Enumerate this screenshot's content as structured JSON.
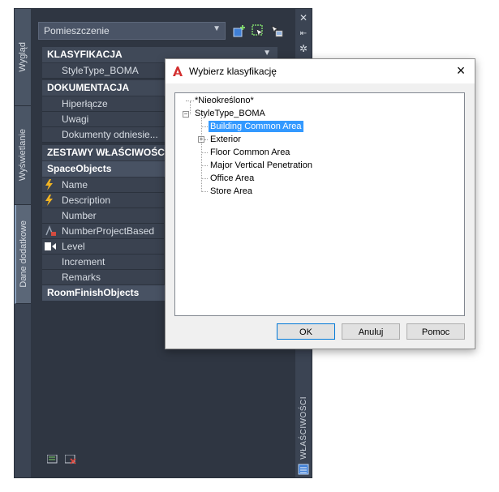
{
  "palette": {
    "side_tabs": [
      "Wygląd",
      "Wyświetlanie",
      "Dane dodatkowe"
    ],
    "dropdown_value": "Pomieszczenie",
    "vertical_title": "WŁAŚCIWOŚCI",
    "sections": {
      "klasyfikacja": {
        "title": "KLASYFIKACJA",
        "rows": [
          "StyleType_BOMA"
        ]
      },
      "dokumentacja": {
        "title": "DOKUMENTACJA",
        "rows": [
          "Hiperłącze",
          "Uwagi",
          "Dokumenty odniesie..."
        ]
      },
      "zestawy": {
        "title": "ZESTAWY WŁAŚCIWOŚCI"
      },
      "space_objects": {
        "title": "SpaceObjects",
        "rows": [
          "Name",
          "Description",
          "Number",
          "NumberProjectBased",
          "Level",
          "Increment",
          "Remarks"
        ]
      },
      "room_finish": {
        "title": "RoomFinishObjects"
      }
    },
    "icons": {
      "add_set": "add-property-set-icon",
      "select_objects": "select-objects-icon",
      "quick_select": "quick-select-icon"
    }
  },
  "dialog": {
    "title": "Wybierz klasyfikację",
    "tree": {
      "unspecified": "*Nieokreślono*",
      "root": "StyleType_BOMA",
      "children": [
        "Building Common Area",
        "Exterior",
        "Floor Common Area",
        "Major Vertical Penetration",
        "Office Area",
        "Store Area"
      ],
      "selected": "Building Common Area"
    },
    "buttons": {
      "ok": "OK",
      "cancel": "Anuluj",
      "help": "Pomoc"
    }
  },
  "colors": {
    "palette_bg": "#2f3642",
    "selection": "#3399ff",
    "autocad_red": "#d32f2f"
  }
}
